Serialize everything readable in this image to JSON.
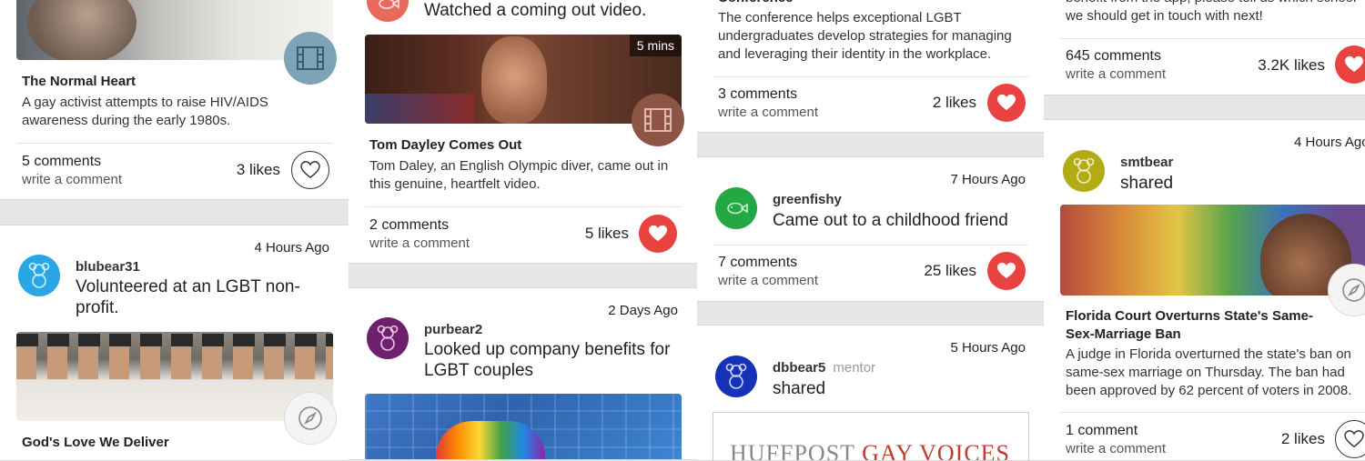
{
  "colors": {
    "heart_active": "#e84340",
    "bg": "#e6e6e6"
  },
  "col1": {
    "card1": {
      "title": "The Normal Heart",
      "desc": "A gay activist attempts to raise HIV/AIDS awareness during the early 1980s.",
      "comments": "5 comments",
      "write": "write a comment",
      "likes": "3 likes",
      "liked": false,
      "badge_icon": "film-icon"
    },
    "card2": {
      "time": "4 Hours Ago",
      "user": "blubear31",
      "action": "Volunteered at an LGBT non-profit.",
      "title": "God's Love We Deliver",
      "badge_icon": "compass-icon"
    }
  },
  "col2": {
    "card1": {
      "action": "Watched a coming out video.",
      "duration": "5 mins",
      "title": "Tom Dayley Comes Out",
      "desc": "Tom Daley, an English Olympic diver, came out in this genuine, heartfelt video.",
      "comments": "2 comments",
      "write": "write a comment",
      "likes": "5 likes",
      "liked": true,
      "badge_icon": "film-icon"
    },
    "card2": {
      "time": "2 Days Ago",
      "user": "purbear2",
      "action": "Looked up company benefits for LGBT couples"
    }
  },
  "col3": {
    "card1": {
      "title_partial": "Conference",
      "desc": "The conference helps exceptional LGBT undergraduates develop strategies for managing and leveraging their identity in the workplace.",
      "comments": "3 comments",
      "write": "write a comment",
      "likes": "2 likes",
      "liked": true
    },
    "card2": {
      "time": "7 Hours Ago",
      "user": "greenfishy",
      "action": "Came out to a childhood friend",
      "comments": "7 comments",
      "write": "write a comment",
      "likes": "25 likes",
      "liked": true
    },
    "card3": {
      "time": "5 Hours Ago",
      "user": "dbbear5",
      "role": "mentor",
      "action": "shared",
      "preview_text_a": "HUFFPOST",
      "preview_text_b": "GAY VOICES"
    }
  },
  "col4": {
    "card1": {
      "desc_partial": "benefit from the app, please tell us which school we should get in touch with next!",
      "comments": "645 comments",
      "write": "write a comment",
      "likes": "3.2K likes",
      "liked": true
    },
    "card2": {
      "time": "4 Hours Ago",
      "user": "smtbear",
      "action": "shared",
      "title": "Florida Court Overturns State's Same-Sex-Marriage Ban",
      "desc": "A judge in Florida overturned the state's ban on same-sex marriage on Thursday. The ban had been approved by 62 percent of voters in 2008.",
      "comments": "1 comment",
      "write": "write a comment",
      "likes": "2 likes",
      "liked": false,
      "badge_icon": "compass-icon"
    }
  }
}
